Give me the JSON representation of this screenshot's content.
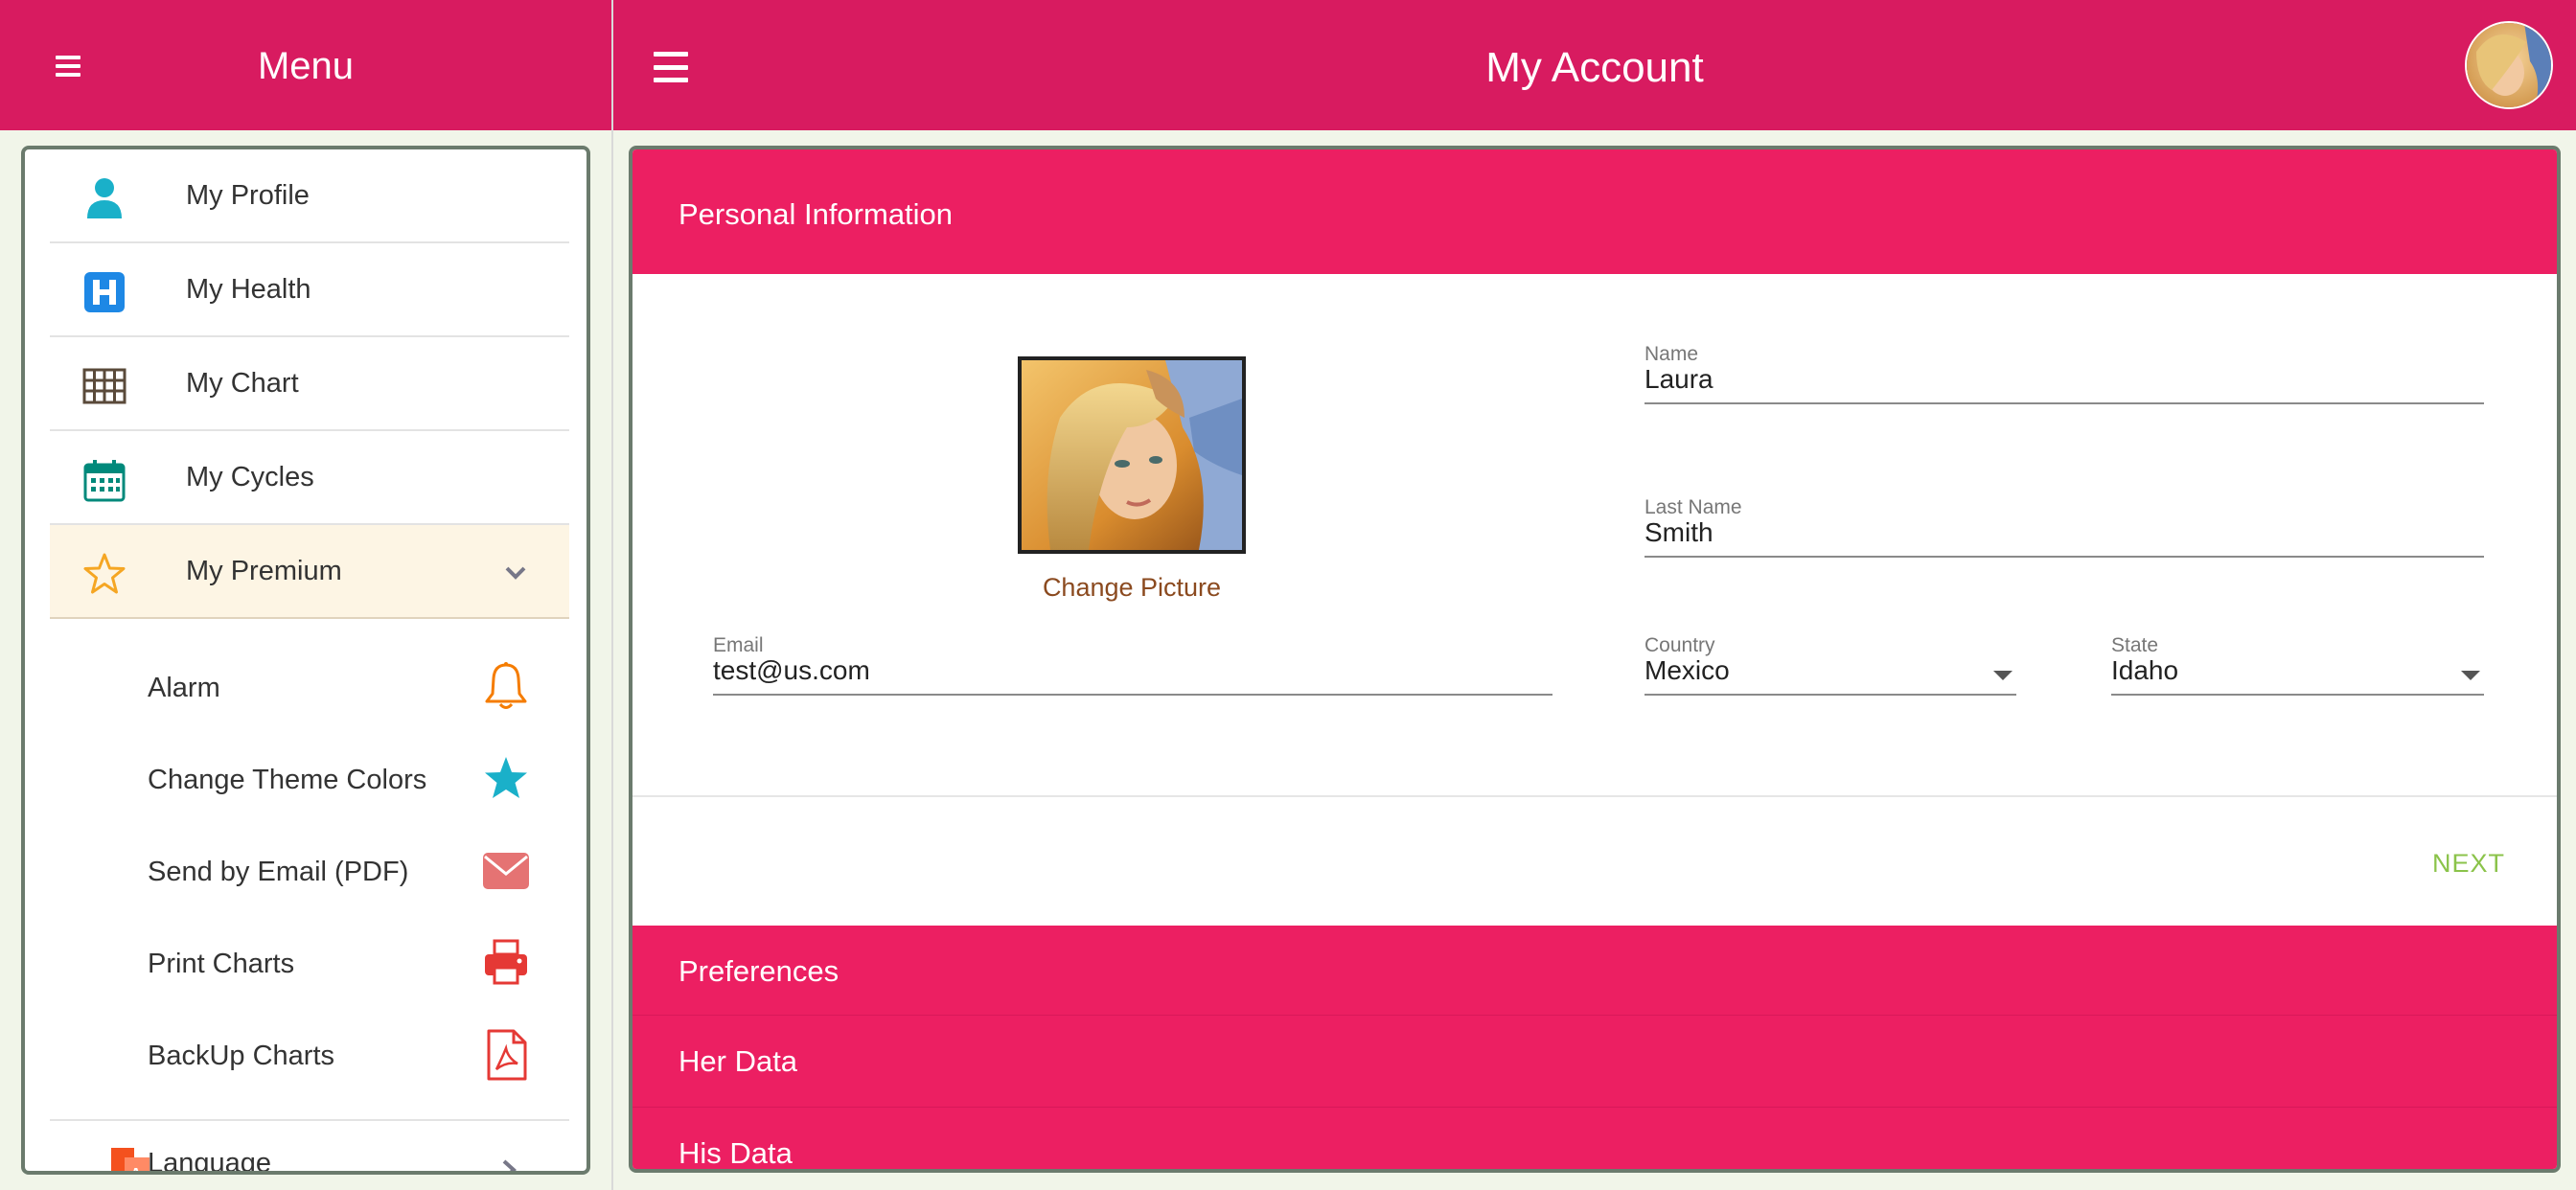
{
  "sidebar": {
    "title": "Menu",
    "items": [
      {
        "label": "My Profile",
        "icon": "person-icon"
      },
      {
        "label": "My Health",
        "icon": "hospital-icon"
      },
      {
        "label": "My Chart",
        "icon": "grid-icon"
      },
      {
        "label": "My Cycles",
        "icon": "calendar-icon"
      },
      {
        "label": "My Premium",
        "icon": "star-outline-icon"
      }
    ],
    "premium_sub": [
      {
        "label": "Alarm",
        "icon": "bell-icon"
      },
      {
        "label": "Change Theme Colors",
        "icon": "star-icon"
      },
      {
        "label": "Send by Email (PDF)",
        "icon": "envelope-icon"
      },
      {
        "label": "Print Charts",
        "icon": "printer-icon"
      },
      {
        "label": "BackUp Charts",
        "icon": "pdf-icon"
      }
    ],
    "language": {
      "label": "Language",
      "icon": "translate-icon"
    }
  },
  "header": {
    "title": "My Account"
  },
  "sections": {
    "personal": "Personal Information",
    "preferences": "Preferences",
    "her_data": "Her Data",
    "his_data": "His Data"
  },
  "form": {
    "change_picture": "Change Picture",
    "name": {
      "label": "Name",
      "value": "Laura"
    },
    "last_name": {
      "label": "Last Name",
      "value": "Smith"
    },
    "email": {
      "label": "Email",
      "value": "test@us.com"
    },
    "country": {
      "label": "Country",
      "value": "Mexico"
    },
    "state": {
      "label": "State",
      "value": "Idaho"
    },
    "next": "NEXT"
  },
  "colors": {
    "primary": "#d81b60",
    "section": "#ec1f62",
    "next": "#8bc34a",
    "change_picture": "#8b4a1f"
  }
}
